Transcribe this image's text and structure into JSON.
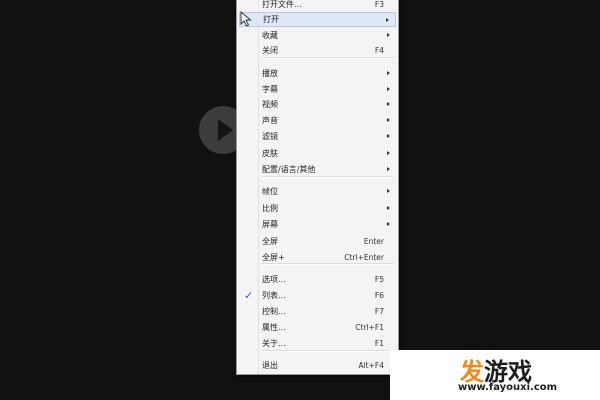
{
  "menu": {
    "items": [
      {
        "label": "打开文件...",
        "shortcut": "F3",
        "submenu": false,
        "checked": false,
        "highlighted": false
      },
      {
        "label": "打开",
        "shortcut": "",
        "submenu": true,
        "checked": false,
        "highlighted": true
      },
      {
        "label": "收藏",
        "shortcut": "",
        "submenu": true,
        "checked": false,
        "highlighted": false
      },
      {
        "label": "关闭",
        "shortcut": "F4",
        "submenu": false,
        "checked": false,
        "highlighted": false
      },
      {
        "label": "播放",
        "shortcut": "",
        "submenu": true,
        "checked": false,
        "highlighted": false
      },
      {
        "label": "字幕",
        "shortcut": "",
        "submenu": true,
        "checked": false,
        "highlighted": false
      },
      {
        "label": "视频",
        "shortcut": "",
        "submenu": true,
        "checked": false,
        "highlighted": false
      },
      {
        "label": "声音",
        "shortcut": "",
        "submenu": true,
        "checked": false,
        "highlighted": false
      },
      {
        "label": "滤镜",
        "shortcut": "",
        "submenu": true,
        "checked": false,
        "highlighted": false
      },
      {
        "label": "皮肤",
        "shortcut": "",
        "submenu": true,
        "checked": false,
        "highlighted": false
      },
      {
        "label": "配置/语言/其他",
        "shortcut": "",
        "submenu": true,
        "checked": false,
        "highlighted": false
      },
      {
        "label": "帧位",
        "shortcut": "",
        "submenu": true,
        "checked": false,
        "highlighted": false
      },
      {
        "label": "比例",
        "shortcut": "",
        "submenu": true,
        "checked": false,
        "highlighted": false
      },
      {
        "label": "屏幕",
        "shortcut": "",
        "submenu": true,
        "checked": false,
        "highlighted": false
      },
      {
        "label": "全屏",
        "shortcut": "Enter",
        "submenu": false,
        "checked": false,
        "highlighted": false
      },
      {
        "label": "全屏+",
        "shortcut": "Ctrl+Enter",
        "submenu": false,
        "checked": false,
        "highlighted": false
      },
      {
        "label": "选项...",
        "shortcut": "F5",
        "submenu": false,
        "checked": false,
        "highlighted": false
      },
      {
        "label": "列表...",
        "shortcut": "F6",
        "submenu": false,
        "checked": true,
        "highlighted": false
      },
      {
        "label": "控制...",
        "shortcut": "F7",
        "submenu": false,
        "checked": false,
        "highlighted": false
      },
      {
        "label": "属性...",
        "shortcut": "Ctrl+F1",
        "submenu": false,
        "checked": false,
        "highlighted": false
      },
      {
        "label": "关于...",
        "shortcut": "F1",
        "submenu": false,
        "checked": false,
        "highlighted": false
      },
      {
        "label": "退出",
        "shortcut": "Alt+F4",
        "submenu": false,
        "checked": false,
        "highlighted": false
      }
    ],
    "separator_after": [
      3,
      10,
      15,
      20
    ],
    "check_glyph": "✓"
  },
  "player": {
    "play_icon": "play-icon"
  },
  "watermark": {
    "logo_part1": "发",
    "logo_part2": "游戏",
    "url": "www.fayouxi.com"
  },
  "colors": {
    "background": "#111111",
    "menu_background": "#f4f4f4",
    "highlight": "#dfe9f6",
    "check": "#3a56a8",
    "logo_accent": "#f08a1c"
  }
}
